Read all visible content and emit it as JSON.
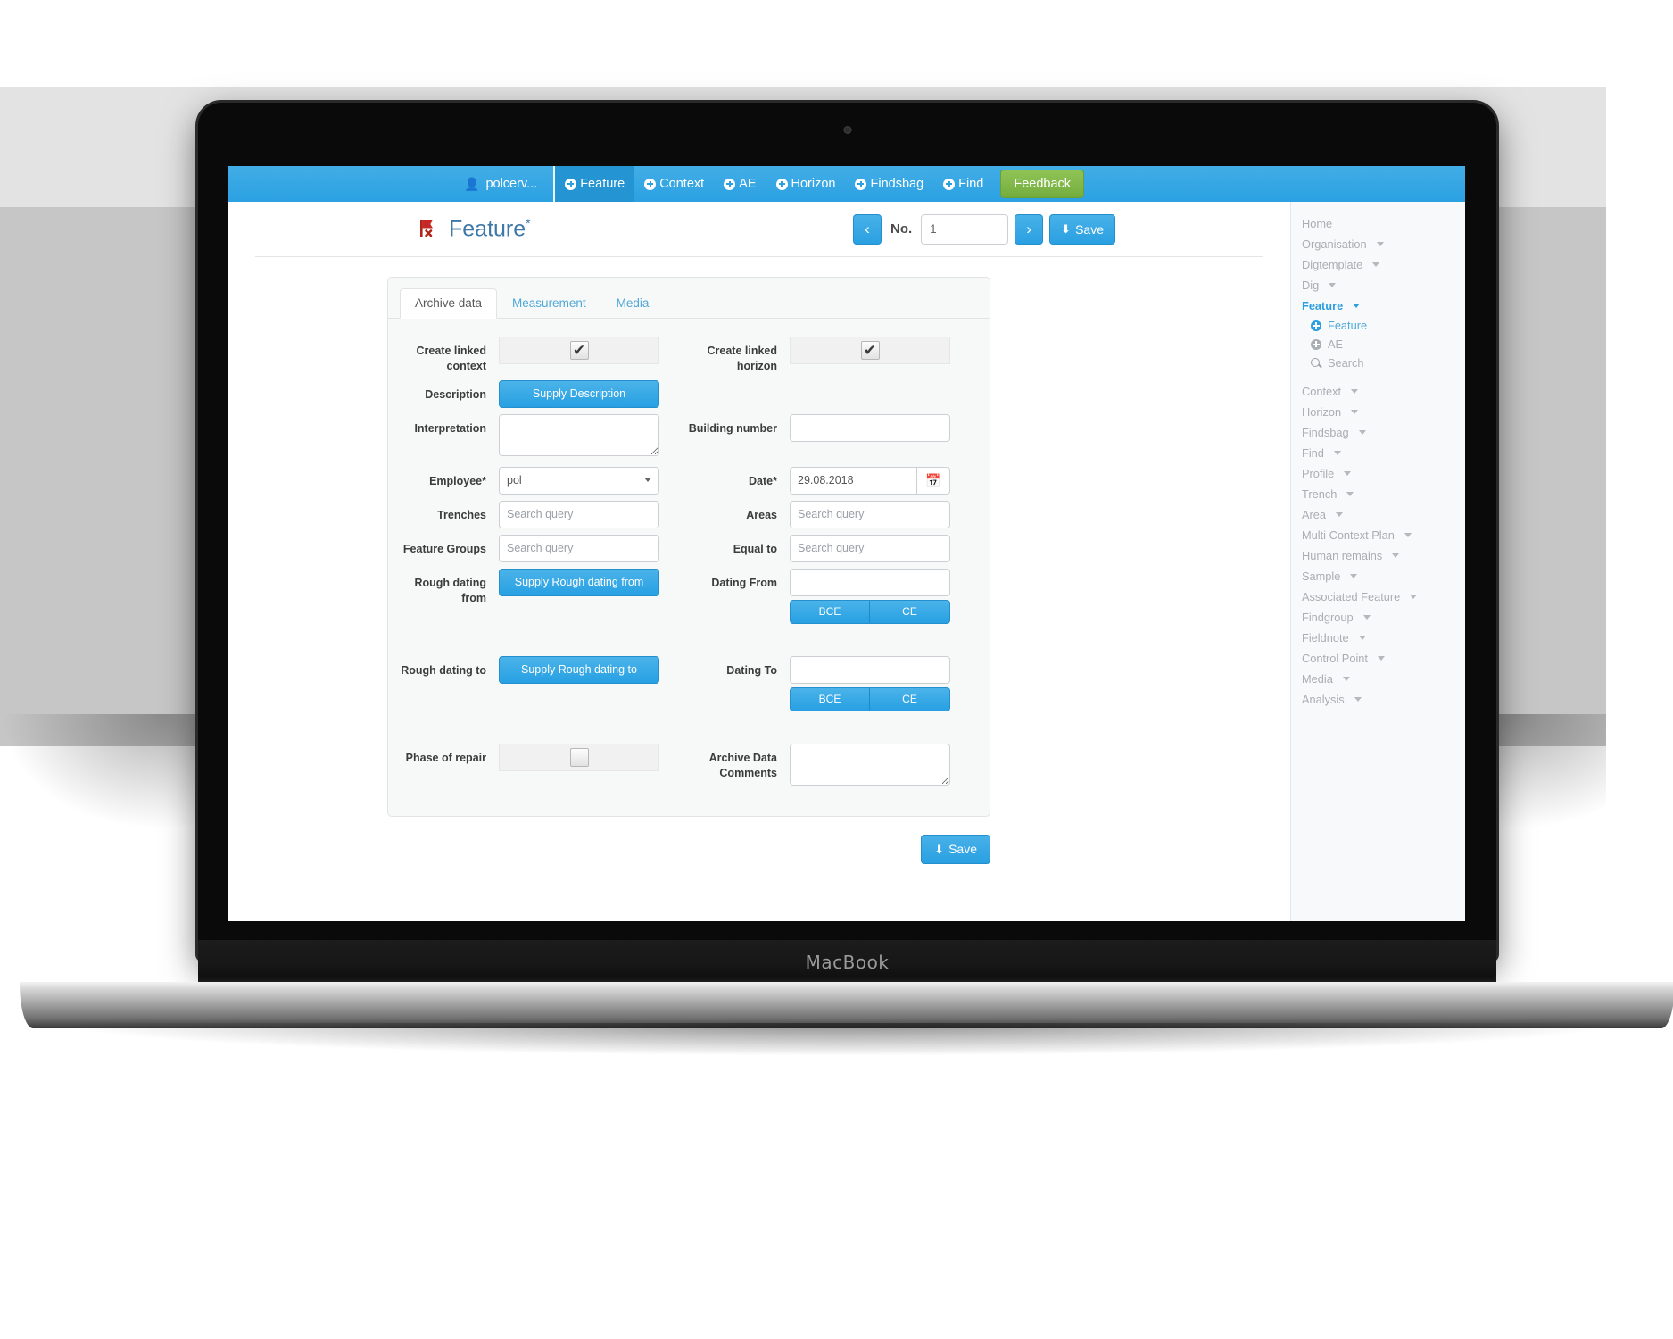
{
  "device": {
    "brand": "MacBook"
  },
  "navbar": {
    "user": "polcerv...",
    "user_icon": "user-icon",
    "items": [
      {
        "label": "Feature",
        "icon": "plus-circle-icon",
        "active": true
      },
      {
        "label": "Context",
        "icon": "plus-circle-icon",
        "active": false
      },
      {
        "label": "AE",
        "icon": "plus-circle-icon",
        "active": false
      },
      {
        "label": "Horizon",
        "icon": "plus-circle-icon",
        "active": false
      },
      {
        "label": "Findsbag",
        "icon": "plus-circle-icon",
        "active": false
      },
      {
        "label": "Find",
        "icon": "plus-circle-icon",
        "active": false
      }
    ],
    "feedback_label": "Feedback",
    "bg_color": "#2ba1e2",
    "feedback_color": "#74ad3e"
  },
  "header": {
    "logo_icon": "red-flag-icon",
    "title": "Feature",
    "asterisk": "*",
    "prev_label": "‹",
    "next_label": "›",
    "no_label": "No.",
    "no_value": "1",
    "save_label": "Save",
    "save_icon": "download-icon",
    "title_color": "#3d78a8"
  },
  "tabs": [
    {
      "label": "Archive data",
      "active": true
    },
    {
      "label": "Measurement",
      "active": false
    },
    {
      "label": "Media",
      "active": false
    }
  ],
  "form": {
    "create_linked_context": {
      "label": "Create linked context",
      "checked": true,
      "mark": "✔"
    },
    "create_linked_horizon": {
      "label": "Create linked horizon",
      "checked": true,
      "mark": "✔"
    },
    "description": {
      "label": "Description",
      "button_label": "Supply Description"
    },
    "interpretation": {
      "label": "Interpretation",
      "value": "",
      "placeholder": ""
    },
    "building_number": {
      "label": "Building number",
      "value": "",
      "placeholder": ""
    },
    "employee": {
      "label": "Employee*",
      "value": "pol",
      "options": [
        "pol"
      ]
    },
    "date": {
      "label": "Date*",
      "value": "29.08.2018",
      "calendar_icon": "calendar-icon"
    },
    "trenches": {
      "label": "Trenches",
      "value": "",
      "placeholder": "Search query"
    },
    "areas": {
      "label": "Areas",
      "value": "",
      "placeholder": "Search query"
    },
    "feature_groups": {
      "label": "Feature Groups",
      "value": "",
      "placeholder": "Search query"
    },
    "equal_to": {
      "label": "Equal to",
      "value": "",
      "placeholder": "Search query"
    },
    "rough_dating_from": {
      "label": "Rough dating from",
      "button_label": "Supply Rough dating from"
    },
    "dating_from": {
      "label": "Dating From",
      "value": "",
      "bce_label": "BCE",
      "ce_label": "CE"
    },
    "rough_dating_to": {
      "label": "Rough dating to",
      "button_label": "Supply Rough dating to"
    },
    "dating_to": {
      "label": "Dating To",
      "value": "",
      "bce_label": "BCE",
      "ce_label": "CE"
    },
    "phase_of_repair": {
      "label": "Phase of repair",
      "checked": false
    },
    "archive_data_comments": {
      "label": "Archive Data Comments",
      "value": "",
      "placeholder": ""
    }
  },
  "footer": {
    "save_label": "Save",
    "save_icon": "download-icon"
  },
  "sidebar": {
    "items": [
      {
        "label": "Home",
        "caret": false,
        "active": false
      },
      {
        "label": "Organisation",
        "caret": true,
        "active": false
      },
      {
        "label": "Digtemplate",
        "caret": true,
        "active": false
      },
      {
        "label": "Dig",
        "caret": true,
        "active": false
      },
      {
        "label": "Feature",
        "caret": true,
        "active": true
      }
    ],
    "sub_items": [
      {
        "label": "Feature",
        "icon": "plus-circle-icon",
        "current": true
      },
      {
        "label": "AE",
        "icon": "plus-circle-icon",
        "current": false
      },
      {
        "label": "Search",
        "icon": "search-icon",
        "current": false
      }
    ],
    "items_after": [
      {
        "label": "Context",
        "caret": true
      },
      {
        "label": "Horizon",
        "caret": true
      },
      {
        "label": "Findsbag",
        "caret": true
      },
      {
        "label": "Find",
        "caret": true
      },
      {
        "label": "Profile",
        "caret": true
      },
      {
        "label": "Trench",
        "caret": true
      },
      {
        "label": "Area",
        "caret": true
      },
      {
        "label": "Multi Context Plan",
        "caret": true
      },
      {
        "label": "Human remains",
        "caret": true
      },
      {
        "label": "Sample",
        "caret": true
      },
      {
        "label": "Associated Feature",
        "caret": true
      },
      {
        "label": "Findgroup",
        "caret": true
      },
      {
        "label": "Fieldnote",
        "caret": true
      },
      {
        "label": "Control Point",
        "caret": true
      },
      {
        "label": "Media",
        "caret": true
      },
      {
        "label": "Analysis",
        "caret": true
      }
    ],
    "active_color": "#2d9fe0"
  }
}
